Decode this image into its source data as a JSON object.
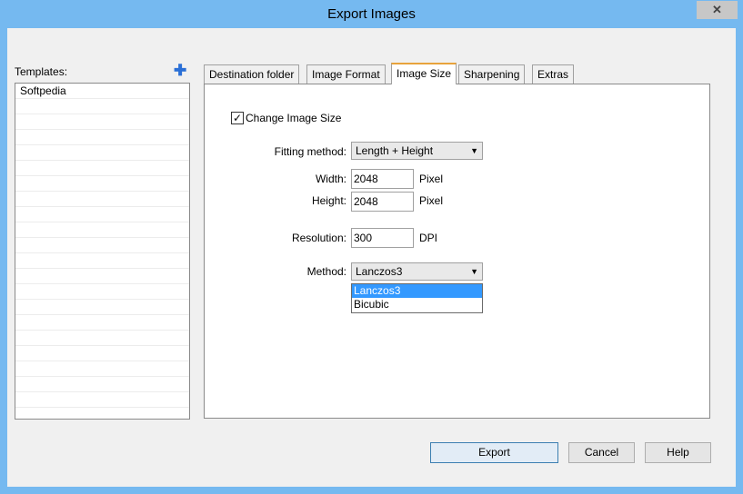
{
  "window": {
    "title": "Export Images",
    "close_glyph": "✕"
  },
  "templates": {
    "label": "Templates:",
    "add_glyph": "✚",
    "items": [
      "Softpedia"
    ]
  },
  "tabs": [
    {
      "label": "Destination folder"
    },
    {
      "label": "Image Format"
    },
    {
      "label": "Image Size"
    },
    {
      "label": "Sharpening"
    },
    {
      "label": "Extras"
    }
  ],
  "active_tab": "Image Size",
  "image_size": {
    "change_size_label": "Change Image Size",
    "change_size_checked": true,
    "check_glyph": "✓",
    "fitting_label": "Fitting method:",
    "fitting_value": "Length + Height",
    "width_label": "Width:",
    "width_value": "2048",
    "width_unit": "Pixel",
    "height_label": "Height:",
    "height_value": "2048",
    "height_unit": "Pixel",
    "resolution_label": "Resolution:",
    "resolution_value": "300",
    "resolution_unit": "DPI",
    "method_label": "Method:",
    "method_value": "Lanczos3",
    "method_options": [
      "Lanczos3",
      "Bicubic"
    ],
    "dropdown_arrow": "▼"
  },
  "buttons": {
    "export": "Export",
    "cancel": "Cancel",
    "help": "Help"
  },
  "colors": {
    "title_bar": "#75b9f0",
    "tab_accent": "#e8a33c",
    "selection": "#3399ff"
  }
}
